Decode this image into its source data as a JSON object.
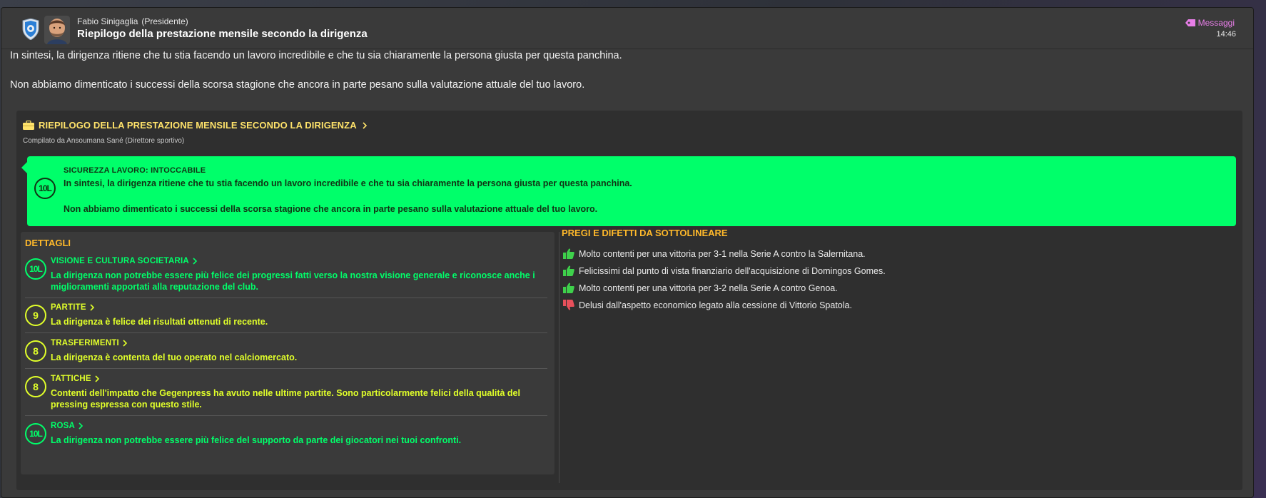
{
  "header": {
    "sender_name": "Fabio Sinigaglia",
    "sender_role": "(Presidente)",
    "subject": "Riepilogo della prestazione mensile secondo la dirigenza",
    "messages_link": "Messaggi",
    "time": "14:46"
  },
  "intro": {
    "p1": "In sintesi, la dirigenza ritiene che tu stia facendo un lavoro incredibile e che tu sia chiaramente la persona giusta per questa panchina.",
    "p2": "Non abbiamo dimenticato i successi della scorsa stagione che ancora in parte pesano sulla valutazione attuale del tuo lavoro."
  },
  "panel": {
    "title": "RIEPILOGO DELLA PRESTAZIONE MENSILE SECONDO LA DIRIGENZA",
    "compiled_by": "Compilato da Ansoumana Sané (Direttore sportivo)",
    "job_security": {
      "rating": "10L",
      "title": "SICUREZZA LAVORO: INTOCCABILE",
      "line1": "In sintesi, la dirigenza ritiene che tu stia facendo un lavoro incredibile e che tu sia chiaramente la persona giusta per questa panchina.",
      "line2": "Non abbiamo dimenticato i successi della scorsa stagione che ancora in parte pesano sulla valutazione attuale del tuo lavoro."
    },
    "details": {
      "title": "DETTAGLI",
      "items": [
        {
          "rating": "10L",
          "title": "VISIONE E CULTURA SOCIETARIA",
          "desc": "La dirigenza non potrebbe essere più felice dei progressi fatti verso la nostra visione generale e riconosce anche i miglioramenti apportati alla reputazione del club."
        },
        {
          "rating": "9",
          "title": "PARTITE",
          "desc": "La dirigenza è felice dei risultati ottenuti di recente."
        },
        {
          "rating": "8",
          "title": "TRASFERIMENTI",
          "desc": "La dirigenza è contenta del tuo operato nel calciomercato."
        },
        {
          "rating": "8",
          "title": "TATTICHE",
          "desc": "Contenti dell'impatto che Gegenpress ha avuto nelle ultime partite. Sono particolarmente felici della qualità del pressing espressa con questo stile."
        },
        {
          "rating": "10L",
          "title": "ROSA",
          "desc": "La dirigenza non potrebbe essere più felice del supporto da parte dei giocatori nei tuoi confronti."
        }
      ]
    },
    "pros_cons": {
      "title": "PREGI E DIFETTI DA SOTTOLINEARE",
      "items": [
        {
          "type": "positive",
          "icon": "thumbs-up-icon",
          "text": "Molto contenti per una vittoria per 3-1 nella Serie A contro la Salernitana."
        },
        {
          "type": "positive",
          "icon": "thumbs-up-icon",
          "text": "Felicissimi dal punto di vista finanziario dell'acquisizione di Domingos Gomes."
        },
        {
          "type": "positive",
          "icon": "thumbs-up-icon",
          "text": "Molto contenti per una vittoria per 3-2 nella Serie A contro Genoa."
        },
        {
          "type": "negative",
          "icon": "thumbs-down-icon",
          "text": "Delusi dall'aspetto economico legato alla cessione di Vittorio Spatola."
        }
      ]
    }
  },
  "colors": {
    "top_rating": "#00ff6a",
    "good_rating": "#e1ff2a",
    "section_title": "#ffb92a",
    "panel_title": "#ffe36a",
    "link": "#e87ee8",
    "thumbs_up": "#3ed14b",
    "thumbs_down": "#e8505b"
  }
}
